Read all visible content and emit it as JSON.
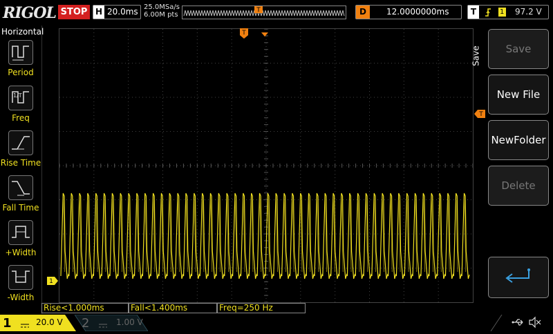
{
  "brand": "RIGOL",
  "run_state": "STOP",
  "horizontal": {
    "label": "H",
    "timebase": "20.0ms"
  },
  "acquisition": {
    "sample_rate": "25.0MSa/s",
    "memory_depth": "6.00M pts"
  },
  "delay": {
    "label": "D",
    "value": "12.0000000ms"
  },
  "trigger": {
    "label": "T",
    "source": "1",
    "level": "97.2 V",
    "marker": "T"
  },
  "left_menu": {
    "title": "Horizontal",
    "items": [
      {
        "label": "Period",
        "icon": "period-icon"
      },
      {
        "label": "Freq",
        "icon": "frequency-icon"
      },
      {
        "label": "Rise Time",
        "icon": "rise-time-icon"
      },
      {
        "label": "Fall Time",
        "icon": "fall-time-icon"
      },
      {
        "label": "+Width",
        "icon": "positive-width-icon"
      },
      {
        "label": "-Width",
        "icon": "negative-width-icon"
      }
    ]
  },
  "right_menu": {
    "title": "Save",
    "buttons": [
      {
        "label": "Save",
        "enabled": false
      },
      {
        "label": "New File",
        "enabled": true
      },
      {
        "label": "NewFolder",
        "enabled": true
      },
      {
        "label": "Delete",
        "enabled": false
      }
    ],
    "return_icon": "enter-return-icon"
  },
  "measurements": [
    "Rise<1.000ms",
    "Fall<1.400ms",
    "Freq=250 Hz"
  ],
  "channels": [
    {
      "number": "1",
      "coupling_icon": "dc-coupling-icon",
      "scale": "20.0 V",
      "active": true,
      "color": "#f0e020"
    },
    {
      "number": "2",
      "coupling_icon": "dc-coupling-icon",
      "scale": "1.00 V",
      "active": false,
      "color": "#3a8aa8"
    }
  ],
  "status_icons": [
    "usb-icon",
    "speaker-muted-icon"
  ],
  "ch1_marker": "1",
  "colors": {
    "trace": "#f0e020",
    "accent": "#f08010",
    "stop": "#d42020"
  },
  "waveform": {
    "cycles": 50
  }
}
